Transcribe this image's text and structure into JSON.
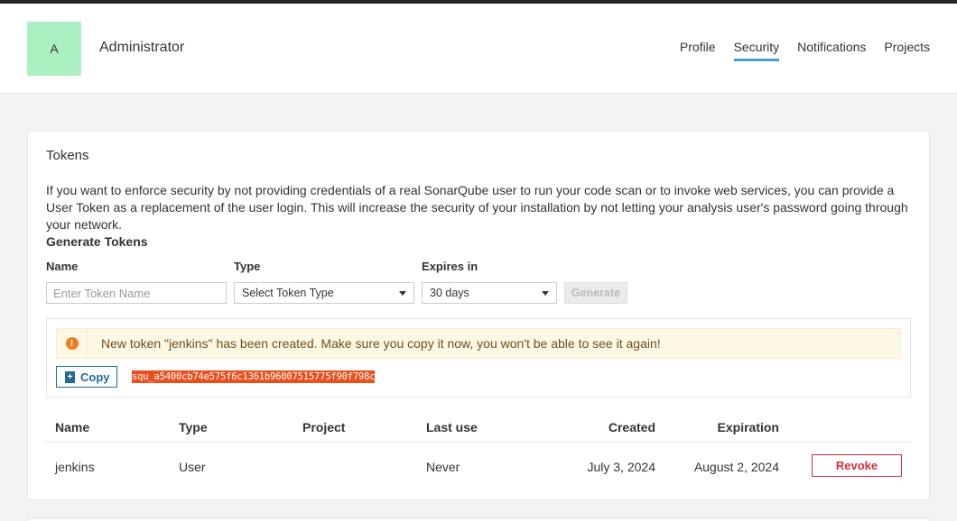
{
  "user": {
    "avatar_letter": "A",
    "name": "Administrator"
  },
  "nav": {
    "items": [
      {
        "label": "Profile",
        "active": false
      },
      {
        "label": "Security",
        "active": true
      },
      {
        "label": "Notifications",
        "active": false
      },
      {
        "label": "Projects",
        "active": false
      }
    ]
  },
  "tokens": {
    "title": "Tokens",
    "description": "If you want to enforce security by not providing credentials of a real SonarQube user to run your code scan or to invoke web services, you can provide a User Token as a replacement of the user login. This will increase the security of your installation by not letting your analysis user's password going through your network.",
    "generate": {
      "title": "Generate Tokens",
      "name_label": "Name",
      "name_placeholder": "Enter Token Name",
      "name_value": "",
      "type_label": "Type",
      "type_value": "Select Token Type",
      "expires_label": "Expires in",
      "expires_value": "30 days",
      "generate_label": "Generate"
    },
    "new_token": {
      "message": "New token \"jenkins\" has been created. Make sure you copy it now, you won't be able to see it again!",
      "copy_label": "Copy",
      "value": "squ_a5400cb74e575f6c1361b96007515775f90f798c"
    },
    "table": {
      "headers": {
        "name": "Name",
        "type": "Type",
        "project": "Project",
        "last_use": "Last use",
        "created": "Created",
        "expiration": "Expiration"
      },
      "rows": [
        {
          "name": "jenkins",
          "type": "User",
          "project": "",
          "last_use": "Never",
          "created": "July 3, 2024",
          "expiration": "August 2, 2024",
          "action": "Revoke"
        }
      ]
    }
  },
  "colors": {
    "accent": "#4b9fd5",
    "avatar_bg": "#aaf0c0",
    "copy_button": "#236a97",
    "revoke_button": "#d02f3a",
    "token_highlight": "#e8501e",
    "alert_bg": "#fcf8e3"
  }
}
